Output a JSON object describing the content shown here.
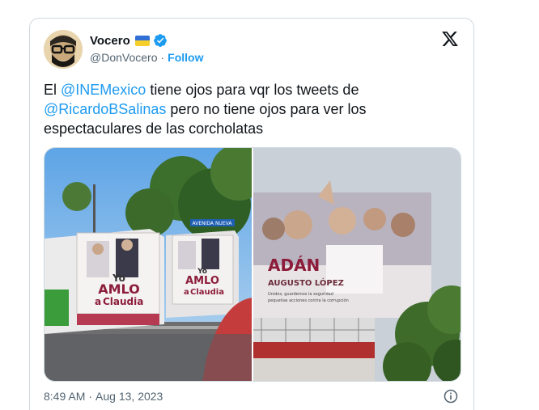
{
  "author": {
    "display_name": "Vocero",
    "handle": "@DonVocero",
    "separator": "·",
    "follow_label": "Follow",
    "flag_icon": "ukraine-flag-icon",
    "verified_icon": "verified-badge-icon",
    "verified_color": "#1d9bf0"
  },
  "tweet": {
    "text_prefix": "El ",
    "mention_1": "@INEMexico",
    "text_mid": " tiene ojos para vqr los tweets de ",
    "mention_2": "@RicardoBSalinas",
    "text_suffix": " pero no tiene ojos para ver los espectaculares de las corcholatas"
  },
  "media": {
    "photo_left": {
      "sign_text": "AVENIDA NUEVA",
      "bus_front": {
        "line_1": "Yo",
        "line_2": "AMLO",
        "line_3": "a",
        "line_4": "Claudia"
      },
      "bus_back": {
        "line_1": "Yo",
        "line_2": "AMLO",
        "line_3": "a",
        "line_4": "Claudia"
      }
    },
    "photo_right": {
      "line_1": "ADÁN",
      "line_2": "AUGUSTO LÓPEZ",
      "line_3": "Unidos, guardemos la seguridad",
      "line_4": "pequeñas acciones contra la corrupción"
    }
  },
  "footer": {
    "time": "8:49 AM",
    "separator": "·",
    "date": "Aug 13, 2023",
    "info_icon": "info-icon"
  },
  "colors": {
    "link": "#1d9bf0",
    "text": "#0f1419",
    "secondary": "#536471",
    "border": "#cfd9de"
  }
}
